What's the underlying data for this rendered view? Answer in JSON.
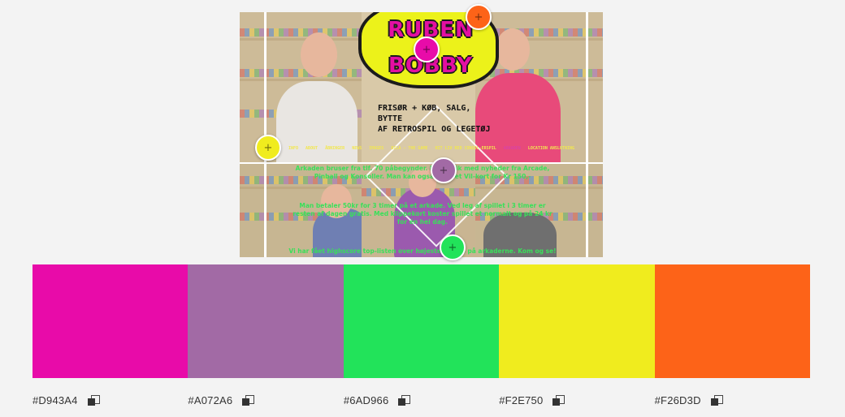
{
  "preview": {
    "logo_line1": "RUBEN",
    "logo_line2": "BOBBY",
    "tagline": "FRISØR + KØB, SALG, BYTTE\nAF RETROSPIL OG LEGETØJ",
    "nav": [
      "INFO",
      "ABOUT",
      "ÅBNINGER",
      "NEWS",
      "IMAGES",
      "BILA - THE GAME",
      "HIT LIV RED CONSOL-ERSPIL",
      "ARKADEN",
      "LOCATION ANSLUTNING"
    ],
    "nav_active_index": 7,
    "copy_top": "Arkaden bruser fra tlf. 70 påbegynder. Ny rubrik med nyheder fra Arcade, Pinball og Konsoller. Man kan også købe et Vil-kort for Kr 150,-",
    "copy_mid": "Man betaler 50kr for 3 timer på et arkade. Ved leg af spillet i 3 timer er resten af dagen gratis. Med klippekort koster spillet et normalt og på 24 kr for én hel dag.",
    "copy_bottom": "Vi har fået highscore top-listen over højeste scores på arkaderne. Kom og se!"
  },
  "pickers": [
    {
      "name": "picker-magenta",
      "color": "#D943A4"
    },
    {
      "name": "picker-purple",
      "color": "#A072A6"
    },
    {
      "name": "picker-green",
      "color": "#6AD966"
    },
    {
      "name": "picker-yellow",
      "color": "#F2E750"
    },
    {
      "name": "picker-orange",
      "color": "#F26D3D"
    }
  ],
  "swatches": [
    {
      "hex": "#D943A4",
      "display": "#e80ba9"
    },
    {
      "hex": "#A072A6",
      "display": "#a26aa5"
    },
    {
      "hex": "#6AD966",
      "display": "#22e35a"
    },
    {
      "hex": "#F2E750",
      "display": "#f0ec1e"
    },
    {
      "hex": "#F26D3D",
      "display": "#fd6318"
    }
  ],
  "icons": {
    "copy": "copy-icon",
    "crosshair": "crosshair-icon"
  }
}
